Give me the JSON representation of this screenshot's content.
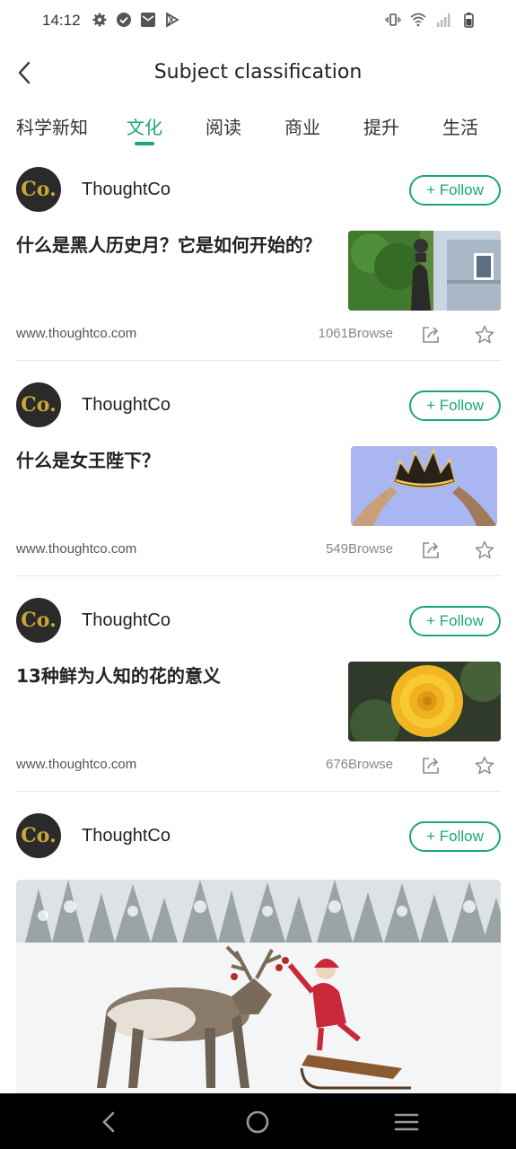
{
  "status_bar": {
    "time": "14:12",
    "left_icons": [
      "gear-icon",
      "check-circle-icon",
      "mail-icon",
      "play-store-icon"
    ],
    "right_icons": [
      "vibrate-icon",
      "wifi-icon",
      "signal-icon",
      "battery-icon"
    ]
  },
  "header": {
    "title": "Subject classification",
    "back_icon": "chevron-left-icon"
  },
  "tabs": [
    {
      "label": "科学新知",
      "active": false
    },
    {
      "label": "文化",
      "active": true
    },
    {
      "label": "阅读",
      "active": false
    },
    {
      "label": "商业",
      "active": false
    },
    {
      "label": "提升",
      "active": false
    },
    {
      "label": "生活",
      "active": false
    }
  ],
  "accent_color": "#1aa77a",
  "cards": [
    {
      "source": "ThoughtCo",
      "avatar_text": "Co.",
      "follow_label": "+ Follow",
      "title": "什么是黑人历史月？它是如何开始的？",
      "url": "www.thoughtco.com",
      "browse": "1061Browse"
    },
    {
      "source": "ThoughtCo",
      "avatar_text": "Co.",
      "follow_label": "+ Follow",
      "title": "什么是女王陛下？",
      "url": "www.thoughtco.com",
      "browse": "549Browse"
    },
    {
      "source": "ThoughtCo",
      "avatar_text": "Co.",
      "follow_label": "+ Follow",
      "title": "13种鲜为人知的花的意义",
      "url": "www.thoughtco.com",
      "browse": "676Browse"
    },
    {
      "source": "ThoughtCo",
      "avatar_text": "Co.",
      "follow_label": "+ Follow"
    }
  ],
  "nav_bar": {
    "icons": [
      "back-triangle-icon",
      "home-circle-icon",
      "menu-lines-icon"
    ]
  }
}
